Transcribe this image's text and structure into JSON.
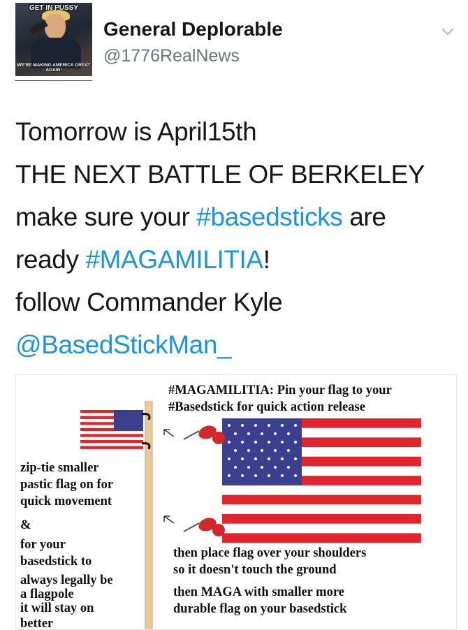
{
  "header": {
    "display_name": "General Deplorable",
    "handle": "@1776RealNews",
    "menu_icon": "chevron-down-icon"
  },
  "avatar": {
    "top_caption": "GET IN PUSSY",
    "bottom_caption": "WE'RE MAKING AMERICA GREAT AGAIN!"
  },
  "tweet": {
    "line1": "Tomorrow is April15th",
    "line2": "THE NEXT BATTLE OF BERKELEY",
    "line3_pre": "make sure your ",
    "line3_hashtag": "#basedsticks",
    "line3_post": " are",
    "line4_pre": "ready ",
    "line4_hashtag": "#MAGAMILITIA",
    "line4_post": "!",
    "line5": "follow Commander Kyle",
    "mention": "@BasedStickMan_"
  },
  "media": {
    "title_line1": "#MAGAMILITIA: Pin your flag to your",
    "title_line2": "#Basedstick for quick action release",
    "left_lines": [
      "zip-tie smaller",
      "pastic flag on for",
      "quick movement",
      "&",
      "for your",
      "basedstick to",
      "always legally be",
      "a flagpole",
      "it will stay on",
      "better"
    ],
    "right_lines": [
      "then place flag over your shoulders",
      "so it doesn't touch the ground",
      "then MAGA with smaller more",
      "durable flag on your basedstick"
    ],
    "colors": {
      "flag_red": "#e0262c",
      "flag_blue": "#3a3f8f",
      "stick": "#e9c99a",
      "pin_red": "#d22a2a"
    }
  }
}
